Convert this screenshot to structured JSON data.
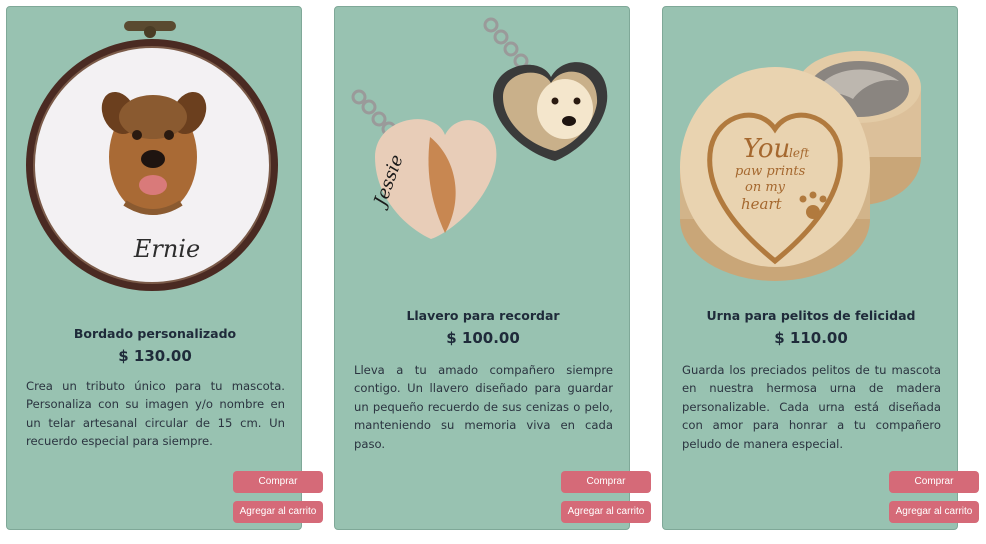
{
  "products": [
    {
      "name": "Bordado personalizado",
      "price": "$ 130.00",
      "description": "Crea un tributo único para tu mascota. Personaliza con su imagen y/o nombre en un telar artesanal circular de 15 cm. Un recuerdo especial para siempre.",
      "image_text": "Ernie",
      "buy_label": "Comprar",
      "cart_label": "Agregar al carrito"
    },
    {
      "name": "Llavero para recordar",
      "price": "$ 100.00",
      "description": "Lleva a tu amado compañero siempre contigo. Un llavero diseñado para guardar un pequeño recuerdo de sus cenizas o pelo, manteniendo su memoria viva en cada paso.",
      "image_text": "Jessie",
      "buy_label": "Comprar",
      "cart_label": "Agregar al carrito"
    },
    {
      "name": "Urna para pelitos de felicidad",
      "price": "$ 110.00",
      "description": "Guarda los preciados pelitos de tu mascota en nuestra hermosa urna de madera personalizable. Cada urna está diseñada con amor para honrar a tu compañero peludo de manera especial.",
      "image_text": [
        "You",
        "left",
        "paw prints",
        "on my",
        "heart"
      ],
      "buy_label": "Comprar",
      "cart_label": "Agregar al carrito"
    }
  ],
  "colors": {
    "card_bg": "#98c2b1",
    "button_bg": "#d56a78",
    "text_dark": "#1f2b3a"
  }
}
